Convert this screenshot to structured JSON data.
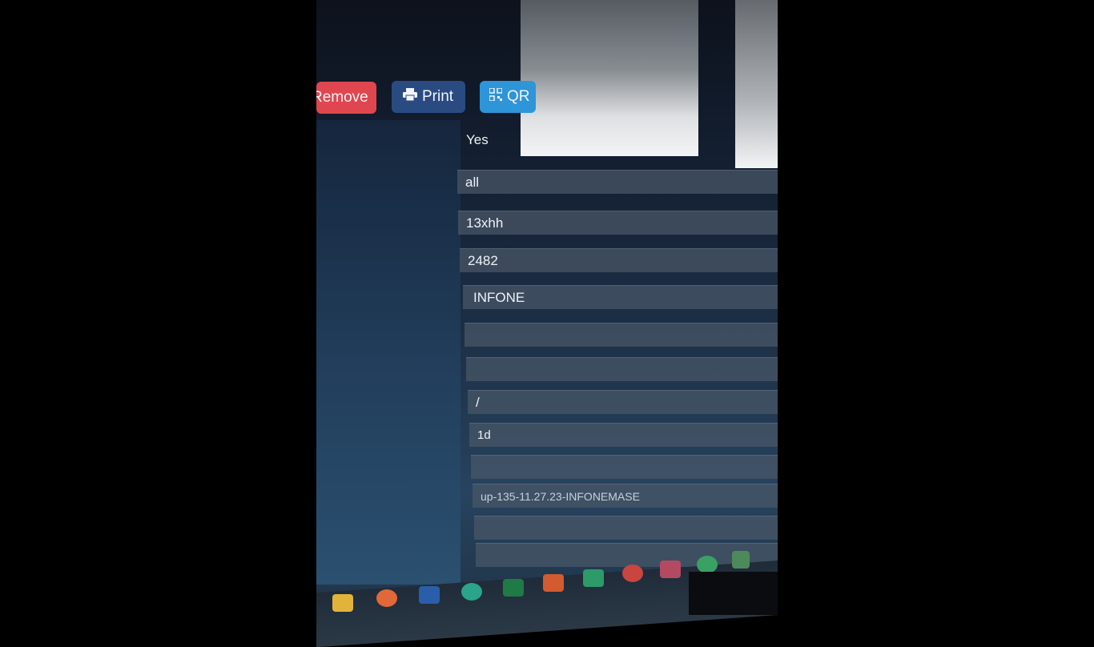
{
  "toolbar": {
    "remove_label": "Remove",
    "print_label": "Print",
    "qr_label": "QR"
  },
  "form": {
    "rows": [
      "Yes",
      "all",
      "13xhh",
      "2482",
      "INFONE",
      "",
      "",
      "/",
      "1d",
      "",
      "up-135-11.27.23-INFONEMASE",
      "",
      ""
    ]
  },
  "taskbar": {
    "icons": [
      "file-explorer-icon",
      "firefox-icon",
      "word-icon",
      "edge-icon",
      "excel-icon",
      "powerpoint-icon",
      "mail-icon",
      "chrome-icon",
      "calendar-icon",
      "teams-icon",
      "app-icon"
    ]
  },
  "colors": {
    "remove": "#e0464f",
    "print": "#2a4b82",
    "qr": "#2e95d9",
    "field": "#4a5868"
  }
}
